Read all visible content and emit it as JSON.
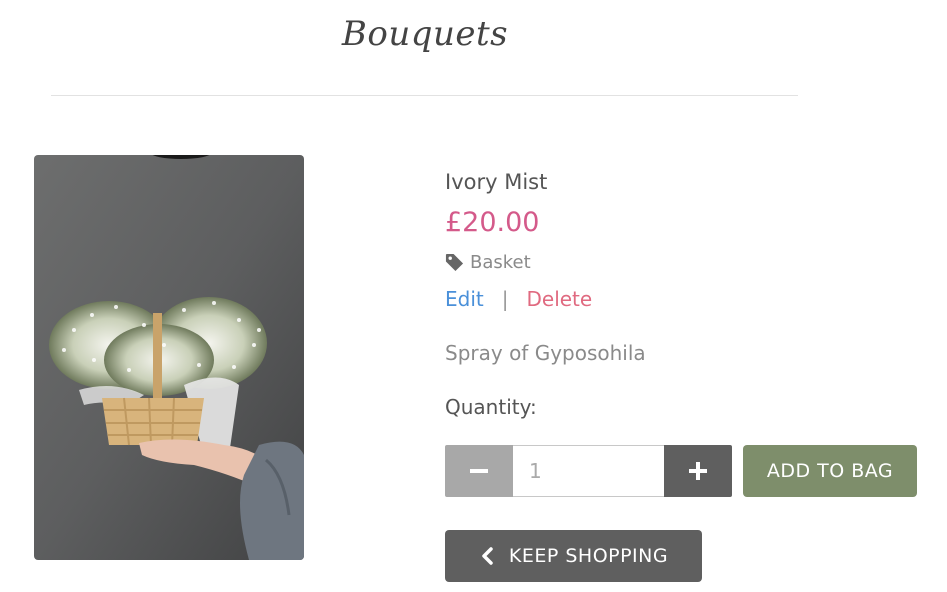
{
  "page": {
    "title": "Bouquets"
  },
  "product": {
    "name": "Ivory Mist",
    "price": "£20.00",
    "category": "Basket",
    "description": "Spray of Gyposohila",
    "image_icon": "product-photo-basket-of-gypsophila"
  },
  "admin": {
    "edit_label": "Edit",
    "separator": "|",
    "delete_label": "Delete"
  },
  "quantity": {
    "label": "Quantity:",
    "value": "1"
  },
  "actions": {
    "add_to_bag_label": "ADD TO BAG",
    "keep_shopping_label": "KEEP SHOPPING"
  },
  "colors": {
    "price": "#d45a8a",
    "edit": "#4a90d9",
    "delete": "#e06a80",
    "add_to_bag_bg": "#7e8e6b",
    "keep_shopping_bg": "#5f5f5f",
    "qty_minus_bg": "#a8a8a8",
    "qty_plus_bg": "#5f5f5f"
  }
}
